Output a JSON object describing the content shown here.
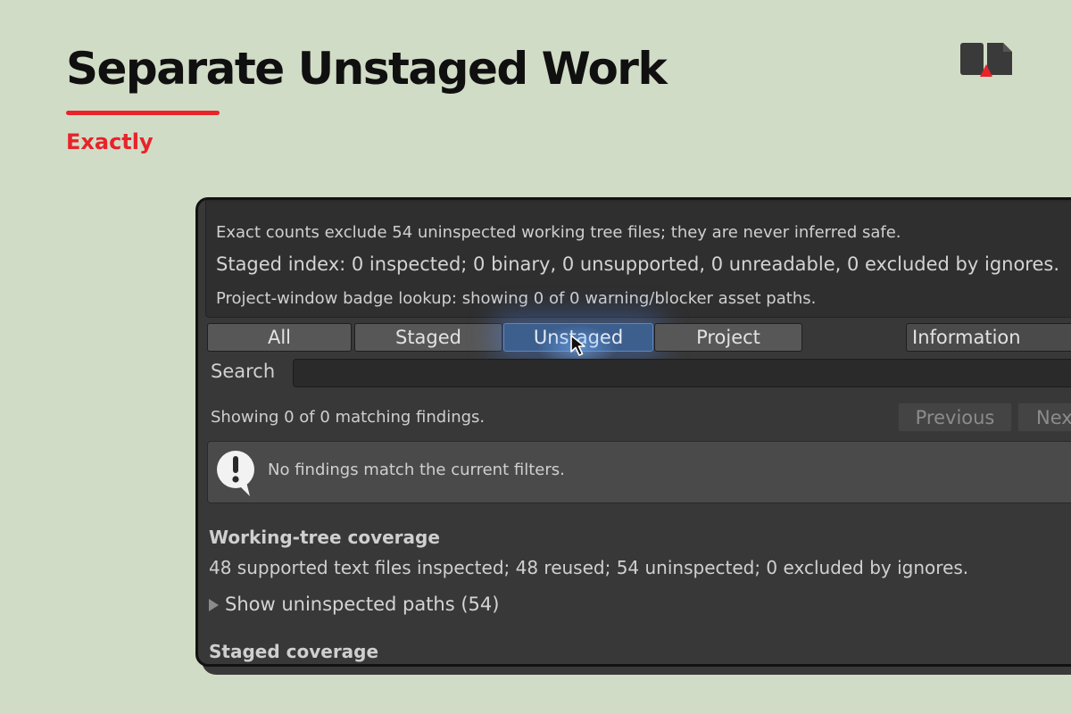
{
  "slide": {
    "title": "Separate Unstaged Work",
    "subtitle": "Exactly",
    "accent_color": "#e8232a",
    "background_color": "#d1dcc6",
    "logo_icon": "brand-logo-icon"
  },
  "panel": {
    "info_lines": [
      "Exact counts exclude 54 uninspected working tree files; they are never inferred safe.",
      "Staged index: 0 inspected; 0 binary, 0 unsupported, 0 unreadable, 0 excluded by ignores.",
      "Project-window badge lookup: showing 0 of 0 warning/blocker asset paths."
    ],
    "tabs": [
      {
        "label": "All",
        "selected": false
      },
      {
        "label": "Staged",
        "selected": false
      },
      {
        "label": "Unstaged",
        "selected": true
      },
      {
        "label": "Project",
        "selected": false
      }
    ],
    "severity_dropdown": {
      "value": "Information"
    },
    "search": {
      "label": "Search",
      "value": ""
    },
    "results": {
      "summary": "Showing 0 of 0 matching findings.",
      "previous_label": "Previous",
      "next_label": "Next"
    },
    "message": {
      "text": "No findings match the current filters.",
      "icon": "alert-speech-bubble-icon"
    },
    "working_tree": {
      "heading": "Working-tree coverage",
      "text": "48 supported text files inspected; 48 reused; 54 uninspected; 0 excluded by ignores.",
      "foldout_label": "Show uninspected paths (54)"
    },
    "staged": {
      "heading": "Staged coverage"
    },
    "selected_tab_color": "#3d5f8d"
  }
}
